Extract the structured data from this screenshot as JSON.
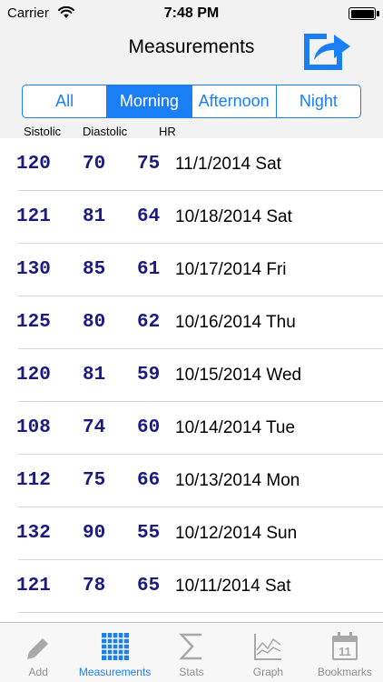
{
  "status_bar": {
    "carrier": "Carrier",
    "time": "7:48 PM"
  },
  "nav": {
    "title": "Measurements",
    "share_icon": "share-icon"
  },
  "segments": [
    {
      "label": "All"
    },
    {
      "label": "Morning"
    },
    {
      "label": "Afternoon"
    },
    {
      "label": "Night"
    }
  ],
  "selected_segment": "Morning",
  "columns": {
    "systolic": "Sistolic",
    "diastolic": "Diastolic",
    "hr": "HR"
  },
  "rows": [
    {
      "sys": "120",
      "dia": "70",
      "hr": "75",
      "date": "11/1/2014 Sat"
    },
    {
      "sys": "121",
      "dia": "81",
      "hr": "64",
      "date": "10/18/2014 Sat"
    },
    {
      "sys": "130",
      "dia": "85",
      "hr": "61",
      "date": "10/17/2014 Fri"
    },
    {
      "sys": "125",
      "dia": "80",
      "hr": "62",
      "date": "10/16/2014 Thu"
    },
    {
      "sys": "120",
      "dia": "81",
      "hr": "59",
      "date": "10/15/2014 Wed"
    },
    {
      "sys": "108",
      "dia": "74",
      "hr": "60",
      "date": "10/14/2014 Tue"
    },
    {
      "sys": "112",
      "dia": "75",
      "hr": "66",
      "date": "10/13/2014 Mon"
    },
    {
      "sys": "132",
      "dia": "90",
      "hr": "55",
      "date": "10/12/2014 Sun"
    },
    {
      "sys": "121",
      "dia": "78",
      "hr": "65",
      "date": "10/11/2014 Sat"
    }
  ],
  "tabs": [
    {
      "label": "Add",
      "icon": "pencil-icon"
    },
    {
      "label": "Measurements",
      "icon": "grid-icon"
    },
    {
      "label": "Stats",
      "icon": "sigma-icon"
    },
    {
      "label": "Graph",
      "icon": "graph-icon"
    },
    {
      "label": "Bookmarks",
      "icon": "calendar-icon",
      "badge": "11"
    }
  ],
  "active_tab": "Measurements",
  "colors": {
    "accent": "#1a7ff5",
    "value_text": "#1a1a80",
    "inactive_icon": "#a8a8a8"
  }
}
